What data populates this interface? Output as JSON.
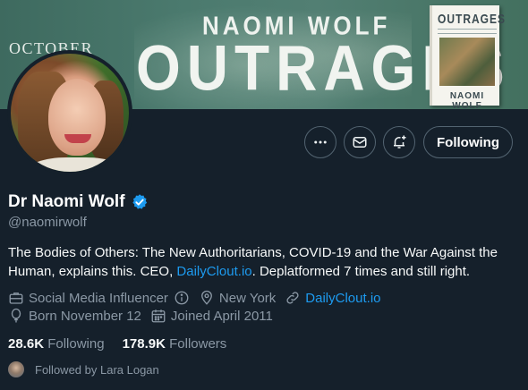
{
  "banner": {
    "month": "OCTOBER",
    "author": "NAOMI WOLF",
    "title": "OUTRAGES",
    "book_title": "OUTRAGES",
    "book_author": "NAOMI WOLF"
  },
  "actions": {
    "more_icon": "more-icon",
    "message_icon": "envelope-icon",
    "notify_icon": "bell-plus-icon",
    "follow_label": "Following"
  },
  "profile": {
    "name": "Dr Naomi Wolf",
    "handle": "@naomirwolf",
    "bio_before_link": "The Bodies of Others: The New Authoritarians, COVID-19 and the War Against the Human, explains this. CEO, ",
    "bio_link": "DailyClout.io",
    "bio_after_link": ". Deplatformed 7 times and still right.",
    "category": "Social Media Influencer",
    "location": "New York",
    "website": "DailyClout.io",
    "born": "Born November 12",
    "joined": "Joined April 2011"
  },
  "stats": {
    "following_count": "28.6K",
    "following_label": "Following",
    "followers_count": "178.9K",
    "followers_label": "Followers"
  },
  "followed_by": "Followed by Lara Logan",
  "colors": {
    "background": "#15202b",
    "accent": "#1d9bf0",
    "secondary_text": "#8b98a5"
  }
}
